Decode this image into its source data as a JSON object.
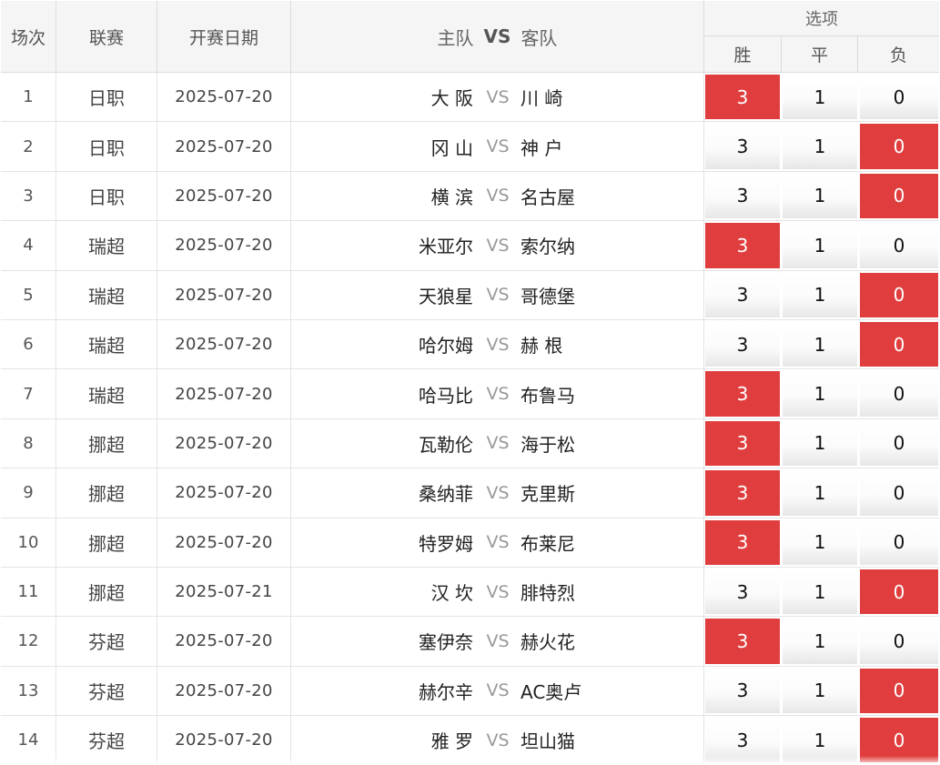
{
  "header": {
    "no": "场次",
    "league": "联赛",
    "date": "开赛日期",
    "home": "主队",
    "vs": "VS",
    "away": "客队",
    "options": "选项",
    "win": "胜",
    "draw": "平",
    "lose": "负"
  },
  "colors": {
    "selected": "#e03e3e",
    "header_bg": "#f5f5f5"
  },
  "rows": [
    {
      "no": "1",
      "league": "日职",
      "date": "2025-07-20",
      "home": "大 阪",
      "vs": "VS",
      "away": "川 崎",
      "win": "3",
      "draw": "1",
      "lose": "0",
      "selected": "win"
    },
    {
      "no": "2",
      "league": "日职",
      "date": "2025-07-20",
      "home": "冈 山",
      "vs": "VS",
      "away": "神 户",
      "win": "3",
      "draw": "1",
      "lose": "0",
      "selected": "lose"
    },
    {
      "no": "3",
      "league": "日职",
      "date": "2025-07-20",
      "home": "横 滨",
      "vs": "VS",
      "away": "名古屋",
      "win": "3",
      "draw": "1",
      "lose": "0",
      "selected": "lose"
    },
    {
      "no": "4",
      "league": "瑞超",
      "date": "2025-07-20",
      "home": "米亚尔",
      "vs": "VS",
      "away": "索尔纳",
      "win": "3",
      "draw": "1",
      "lose": "0",
      "selected": "win"
    },
    {
      "no": "5",
      "league": "瑞超",
      "date": "2025-07-20",
      "home": "天狼星",
      "vs": "VS",
      "away": "哥德堡",
      "win": "3",
      "draw": "1",
      "lose": "0",
      "selected": "lose"
    },
    {
      "no": "6",
      "league": "瑞超",
      "date": "2025-07-20",
      "home": "哈尔姆",
      "vs": "VS",
      "away": "赫 根",
      "win": "3",
      "draw": "1",
      "lose": "0",
      "selected": "lose"
    },
    {
      "no": "7",
      "league": "瑞超",
      "date": "2025-07-20",
      "home": "哈马比",
      "vs": "VS",
      "away": "布鲁马",
      "win": "3",
      "draw": "1",
      "lose": "0",
      "selected": "win"
    },
    {
      "no": "8",
      "league": "挪超",
      "date": "2025-07-20",
      "home": "瓦勒伦",
      "vs": "VS",
      "away": "海于松",
      "win": "3",
      "draw": "1",
      "lose": "0",
      "selected": "win"
    },
    {
      "no": "9",
      "league": "挪超",
      "date": "2025-07-20",
      "home": "桑纳菲",
      "vs": "VS",
      "away": "克里斯",
      "win": "3",
      "draw": "1",
      "lose": "0",
      "selected": "win"
    },
    {
      "no": "10",
      "league": "挪超",
      "date": "2025-07-20",
      "home": "特罗姆",
      "vs": "VS",
      "away": "布莱尼",
      "win": "3",
      "draw": "1",
      "lose": "0",
      "selected": "win"
    },
    {
      "no": "11",
      "league": "挪超",
      "date": "2025-07-21",
      "home": "汉 坎",
      "vs": "VS",
      "away": "腓特烈",
      "win": "3",
      "draw": "1",
      "lose": "0",
      "selected": "lose"
    },
    {
      "no": "12",
      "league": "芬超",
      "date": "2025-07-20",
      "home": "塞伊奈",
      "vs": "VS",
      "away": "赫火花",
      "win": "3",
      "draw": "1",
      "lose": "0",
      "selected": "win"
    },
    {
      "no": "13",
      "league": "芬超",
      "date": "2025-07-20",
      "home": "赫尔辛",
      "vs": "VS",
      "away": "AC奥卢",
      "win": "3",
      "draw": "1",
      "lose": "0",
      "selected": "lose"
    },
    {
      "no": "14",
      "league": "芬超",
      "date": "2025-07-20",
      "home": "雅 罗",
      "vs": "VS",
      "away": "坦山猫",
      "win": "3",
      "draw": "1",
      "lose": "0",
      "selected": "lose"
    }
  ]
}
